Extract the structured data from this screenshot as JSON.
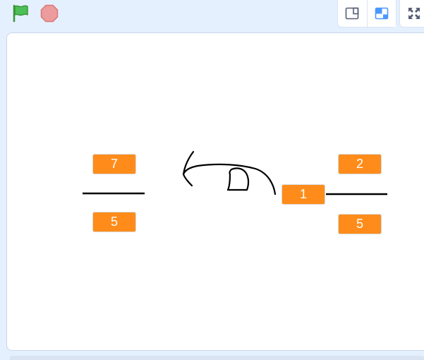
{
  "toolbar": {
    "green_flag_icon": "green-flag-icon",
    "stop_icon": "stop-sign-icon",
    "small_stage_icon": "small-stage-layout-icon",
    "normal_stage_icon": "normal-stage-layout-icon",
    "fullscreen_icon": "fullscreen-icon",
    "accent_color": "#4c97ff",
    "flag_color": "#4cbf56",
    "stop_color": "#ec9c9c"
  },
  "stage": {
    "left_fraction": {
      "numerator": "7",
      "denominator": "5"
    },
    "right_mixed_number": {
      "whole": "1",
      "numerator": "2",
      "denominator": "5"
    },
    "box_color": "#ff8c1a"
  }
}
